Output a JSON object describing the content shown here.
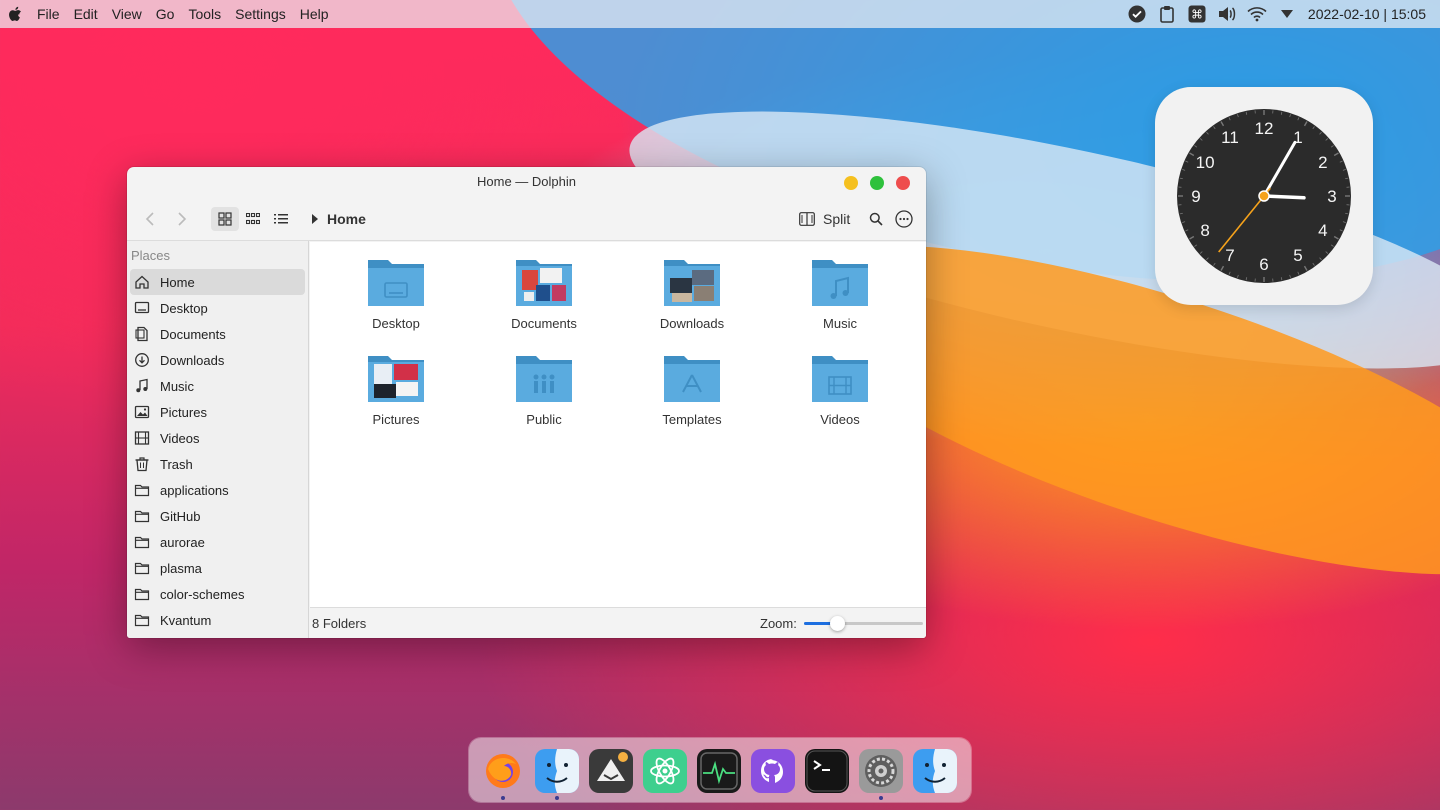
{
  "menubar": {
    "items": [
      "File",
      "Edit",
      "View",
      "Go",
      "Tools",
      "Settings",
      "Help"
    ],
    "datetime": "2022-02-10 | 15:05",
    "tray_icons": [
      "check-circle-icon",
      "clipboard-icon",
      "command-icon",
      "volume-icon",
      "wifi-icon",
      "dropdown-triangle-icon"
    ]
  },
  "window": {
    "title": "Home — Dolphin",
    "breadcrumb": "Home",
    "split_label": "Split",
    "places_header": "Places",
    "places": [
      {
        "label": "Home",
        "icon": "home-icon",
        "active": true
      },
      {
        "label": "Desktop",
        "icon": "desktop-icon"
      },
      {
        "label": "Documents",
        "icon": "documents-icon"
      },
      {
        "label": "Downloads",
        "icon": "downloads-icon"
      },
      {
        "label": "Music",
        "icon": "music-icon"
      },
      {
        "label": "Pictures",
        "icon": "pictures-icon"
      },
      {
        "label": "Videos",
        "icon": "videos-icon"
      },
      {
        "label": "Trash",
        "icon": "trash-icon"
      },
      {
        "label": "applications",
        "icon": "folder-icon"
      },
      {
        "label": "GitHub",
        "icon": "folder-icon"
      },
      {
        "label": "aurorae",
        "icon": "folder-icon"
      },
      {
        "label": "plasma",
        "icon": "folder-icon"
      },
      {
        "label": "color-schemes",
        "icon": "folder-icon"
      },
      {
        "label": "Kvantum",
        "icon": "folder-icon"
      }
    ],
    "folders": [
      {
        "label": "Desktop",
        "icon": "desktop-folder-icon"
      },
      {
        "label": "Documents",
        "icon": "documents-folder-icon"
      },
      {
        "label": "Downloads",
        "icon": "downloads-folder-icon"
      },
      {
        "label": "Music",
        "icon": "music-folder-icon"
      },
      {
        "label": "Pictures",
        "icon": "pictures-folder-icon"
      },
      {
        "label": "Public",
        "icon": "public-folder-icon"
      },
      {
        "label": "Templates",
        "icon": "templates-folder-icon"
      },
      {
        "label": "Videos",
        "icon": "videos-folder-icon"
      }
    ],
    "status": "8 Folders",
    "zoom_label": "Zoom:",
    "zoom_level": 0.28
  },
  "clock_widget": {
    "numerals": [
      "12",
      "1",
      "2",
      "3",
      "4",
      "5",
      "6",
      "7",
      "8",
      "9",
      "10",
      "11"
    ],
    "time": "15:05"
  },
  "dock": {
    "apps": [
      {
        "name": "firefox-icon",
        "running": true
      },
      {
        "name": "finder-icon",
        "running": true
      },
      {
        "name": "inkscape-icon",
        "running": false
      },
      {
        "name": "atom-icon",
        "running": false
      },
      {
        "name": "activity-monitor-icon",
        "running": false
      },
      {
        "name": "github-desktop-icon",
        "running": false
      },
      {
        "name": "terminal-icon",
        "running": false
      },
      {
        "name": "system-settings-icon",
        "running": true
      },
      {
        "name": "finder-icon",
        "running": false
      }
    ]
  },
  "colors": {
    "accent": "#1d6fe0",
    "folder": "#5aabdf",
    "close": "#ee4d4d",
    "maximize": "#2ec13c",
    "minimize": "#f5c01f"
  }
}
